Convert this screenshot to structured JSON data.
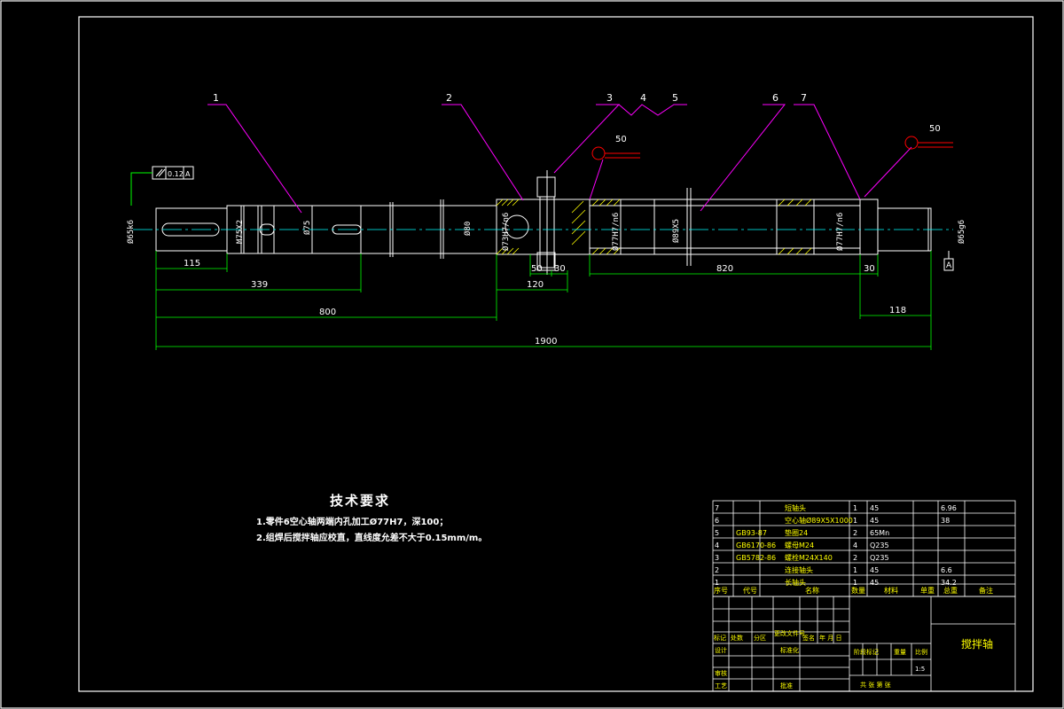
{
  "drawing": {
    "part_numbers": [
      "1",
      "2",
      "3",
      "4",
      "5",
      "6",
      "7"
    ],
    "datum": {
      "flatness_value": "0.12",
      "label": "A"
    },
    "surface_roughness": [
      "50",
      "50"
    ],
    "diameters": [
      "Ø65k6",
      "M75X2",
      "Ø75",
      "Ø80",
      "Ø73H7/n6",
      "Ø77H7/n6",
      "Ø89X5",
      "Ø77H7/n6",
      "Ø65g6"
    ],
    "dimensions": {
      "d115": "115",
      "d339": "339",
      "d800": "800",
      "d120": "120",
      "d50": "50",
      "d30a": "30",
      "d820": "820",
      "d30b": "30",
      "d118": "118",
      "d1900": "1900"
    }
  },
  "tech_requirements": {
    "title": "技术要求",
    "lines": [
      "1.零件6空心轴两端内孔加工Ø77H7，深100；",
      "2.组焊后搅拌轴应校直，直线度允差不大于0.15mm/m。"
    ]
  },
  "parts_table": {
    "rows": [
      {
        "no": "7",
        "code": "",
        "name": "短轴头",
        "qty": "1",
        "material": "45",
        "unit_wt": "",
        "total_wt": "6.96",
        "note": ""
      },
      {
        "no": "6",
        "code": "",
        "name": "空心轴Ø89X5X1000",
        "qty": "1",
        "material": "45",
        "unit_wt": "",
        "total_wt": "38",
        "note": ""
      },
      {
        "no": "5",
        "code": "GB93-87",
        "name": "垫圈24",
        "qty": "2",
        "material": "65Mn",
        "unit_wt": "",
        "total_wt": "",
        "note": ""
      },
      {
        "no": "4",
        "code": "GB6170-86",
        "name": "螺母M24",
        "qty": "4",
        "material": "Q235",
        "unit_wt": "",
        "total_wt": "",
        "note": ""
      },
      {
        "no": "3",
        "code": "GB5782-86",
        "name": "螺栓M24X140",
        "qty": "2",
        "material": "Q235",
        "unit_wt": "",
        "total_wt": "",
        "note": ""
      },
      {
        "no": "2",
        "code": "",
        "name": "连接轴头",
        "qty": "1",
        "material": "45",
        "unit_wt": "",
        "total_wt": "6.6",
        "note": ""
      },
      {
        "no": "1",
        "code": "",
        "name": "长轴头",
        "qty": "1",
        "material": "45",
        "unit_wt": "",
        "total_wt": "34.2",
        "note": ""
      }
    ],
    "header": [
      "序号",
      "代号",
      "名称",
      "数量",
      "材料",
      "单重",
      "总重",
      "备注"
    ]
  },
  "title_block": {
    "revision_labels": [
      "标记",
      "处数",
      "分区",
      "更改文件号",
      "签名",
      "年 月 日"
    ],
    "design": "设计",
    "standardization": "标准化",
    "review": "审核",
    "process": "工艺",
    "approve": "批准",
    "stage_mark": "阶段标记",
    "weight": "重量",
    "scale": "比例",
    "scale_value": "1:5",
    "sheets": "共 张 第 张",
    "drawing_name": "搅拌轴"
  },
  "colors": {
    "outline": "#ffffff",
    "dimension": "#00ff00",
    "leader": "#ff00ff",
    "center": "#00ffff",
    "hatch": "#ffff00",
    "roughness": "#ff0000",
    "table_text": "#ffff00"
  }
}
